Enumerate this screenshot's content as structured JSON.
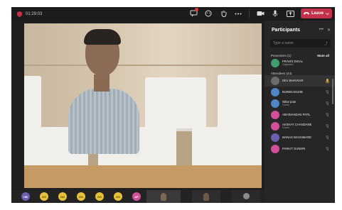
{
  "window": {
    "title": "01:29:03"
  },
  "toolbar": {
    "leave_label": "Leave",
    "icons": [
      "chat-icon",
      "reactions-icon",
      "raise-hand-icon",
      "more-icon",
      "camera-icon",
      "mic-icon",
      "share-icon"
    ]
  },
  "participants": {
    "title": "Participants",
    "search_placeholder": "Type a name",
    "presenters_label": "Presenters (1)",
    "mute_all_label": "Mute all",
    "attendees_label": "Attendees (44)",
    "presenters": [
      {
        "name": "PRAVIN DIGAL",
        "role": "Organizer",
        "color": "#3f9d6e"
      }
    ],
    "attendees": [
      {
        "name": "DEV BHAVSAR",
        "role": "",
        "color": "#6b6b6b",
        "status": "speaking"
      },
      {
        "name": "B19MGA0110B",
        "role": "",
        "color": "#4f86c6",
        "status": "muted"
      },
      {
        "name": "Nihar pote",
        "role": "Guest",
        "color": "#4f86c6",
        "status": "muted"
      },
      {
        "name": "ABHINANDAN PATIL",
        "role": "",
        "color": "#d44f9a",
        "status": "muted"
      },
      {
        "name": "AKSHAY CHANDANE",
        "role": "Guest",
        "color": "#d44f9a",
        "status": "muted"
      },
      {
        "name": "MANAS WAGHMARE",
        "role": "",
        "color": "#6b5fb0",
        "status": "muted"
      },
      {
        "name": "PANKIT GUNDRI",
        "role": "",
        "color": "#d44f9a",
        "status": "muted"
      }
    ]
  },
  "strip": {
    "avatars": [
      {
        "initials": "HB",
        "color": "#6b5fb0",
        "text_color": "#ffffff"
      },
      {
        "initials": "GG",
        "color": "#e6c13a",
        "text_color": "#5a4a10"
      },
      {
        "initials": "GG",
        "color": "#e6c13a",
        "text_color": "#5a4a10"
      },
      {
        "initials": "GG",
        "color": "#e6c13a",
        "text_color": "#5a4a10"
      },
      {
        "initials": "GG",
        "color": "#e6c13a",
        "text_color": "#5a4a10"
      },
      {
        "initials": "GG",
        "color": "#e6c13a",
        "text_color": "#5a4a10"
      },
      {
        "initials": "AP",
        "color": "#d44f9a",
        "text_color": "#ffffff"
      }
    ]
  },
  "colors": {
    "leave": "#c4314b",
    "panel": "#262626",
    "bar": "#1c1c1c"
  }
}
